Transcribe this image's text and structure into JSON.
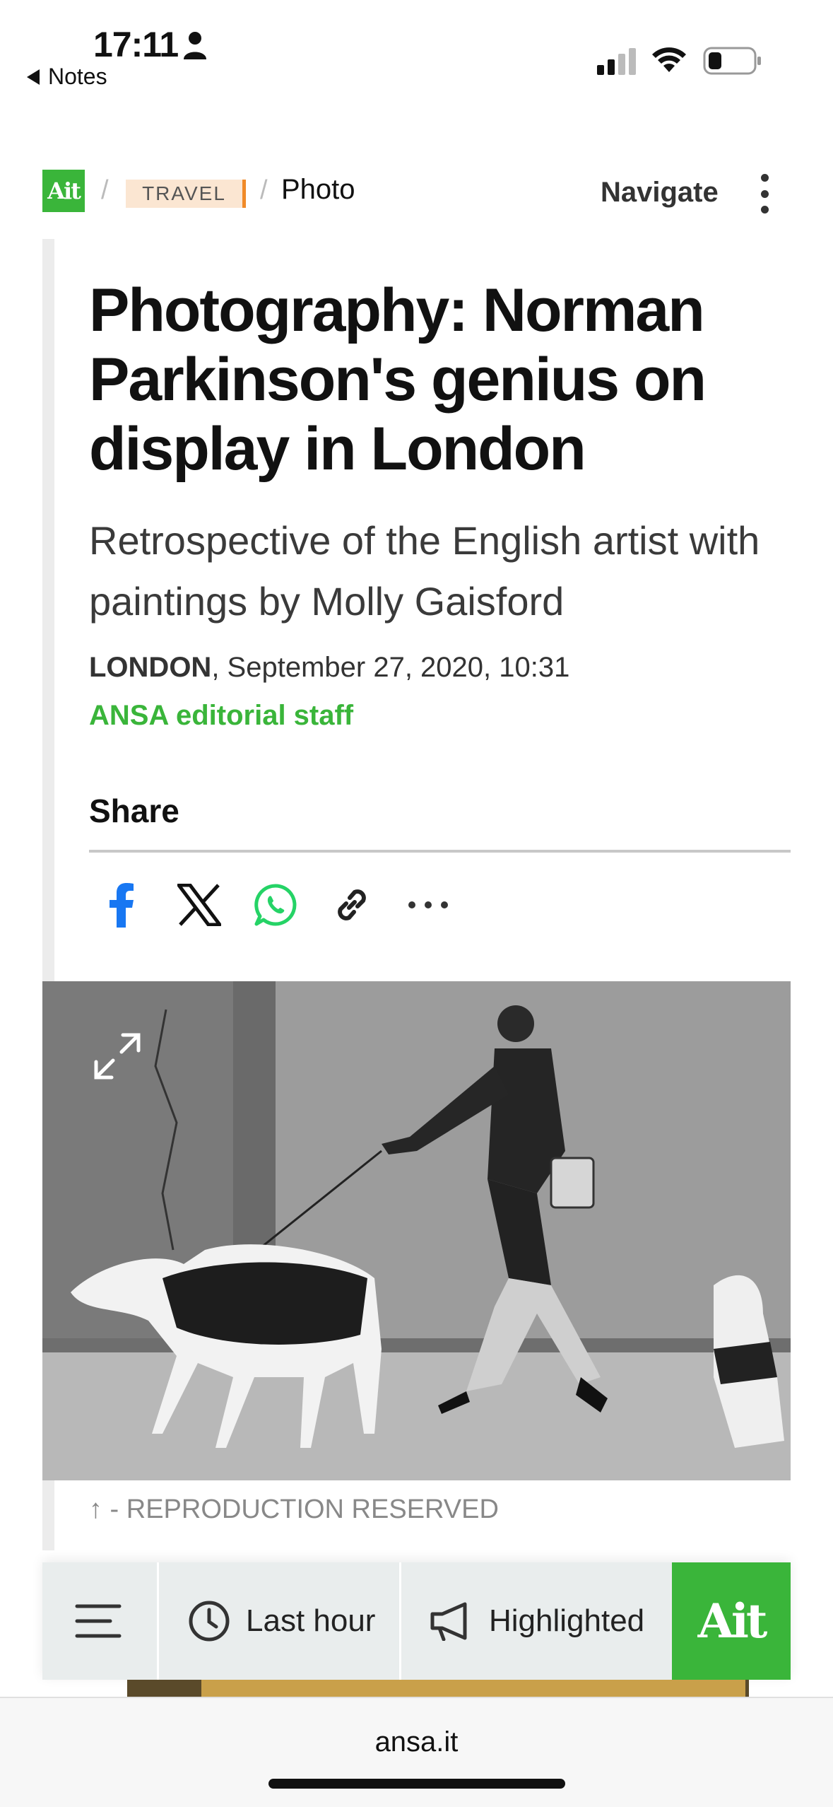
{
  "status_bar": {
    "time": "17:11",
    "back_app": "Notes"
  },
  "nav": {
    "logo_text": "Ait",
    "section": "TRAVEL",
    "page_type": "Photo",
    "navigate_label": "Navigate"
  },
  "article": {
    "headline": "Photography: Norman Parkinson's genius on display in London",
    "subheadline": "Retrospective of the English artist with paintings by Molly Gaisford",
    "location": "LONDON",
    "date": ", September 27, 2020, 10:31",
    "author": "ANSA editorial staff",
    "share_label": "Share",
    "share_icons": [
      "facebook-icon",
      "x-icon",
      "whatsapp-icon",
      "link-icon",
      "more-icon"
    ],
    "caption": "↑ - REPRODUCTION RESERVED"
  },
  "bottom_nav": {
    "last_hour": "Last hour",
    "highlighted": "Highlighted",
    "logo_text": "Ait"
  },
  "browser": {
    "url": "ansa.it"
  },
  "colors": {
    "brand_green": "#3ab53a",
    "travel_tag_bg": "#fbe6d2",
    "travel_tag_accent": "#f08a28",
    "facebook_blue": "#1877f2",
    "whatsapp_green": "#25d366"
  }
}
